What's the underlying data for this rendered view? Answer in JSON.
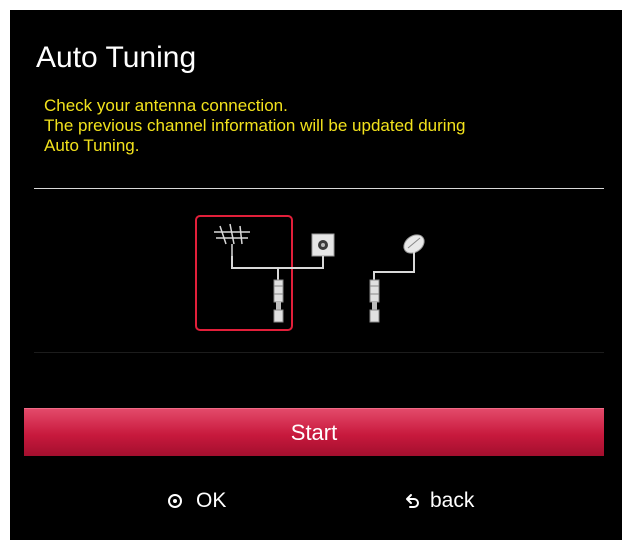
{
  "dialog": {
    "title": "Auto Tuning",
    "message_lines": [
      "Check your antenna connection.",
      "The previous channel information will be updated during",
      "Auto Tuning."
    ]
  },
  "diagram": {
    "options": [
      "antenna-connection",
      "satellite-connection"
    ],
    "selected": "antenna-connection",
    "highlight_color": "#e21f3a"
  },
  "buttons": {
    "start_label": "Start"
  },
  "hints": {
    "ok_label": "OK",
    "back_label": "back"
  },
  "colors": {
    "background": "#000000",
    "message": "#f2e21c",
    "button": "#c8193d"
  }
}
